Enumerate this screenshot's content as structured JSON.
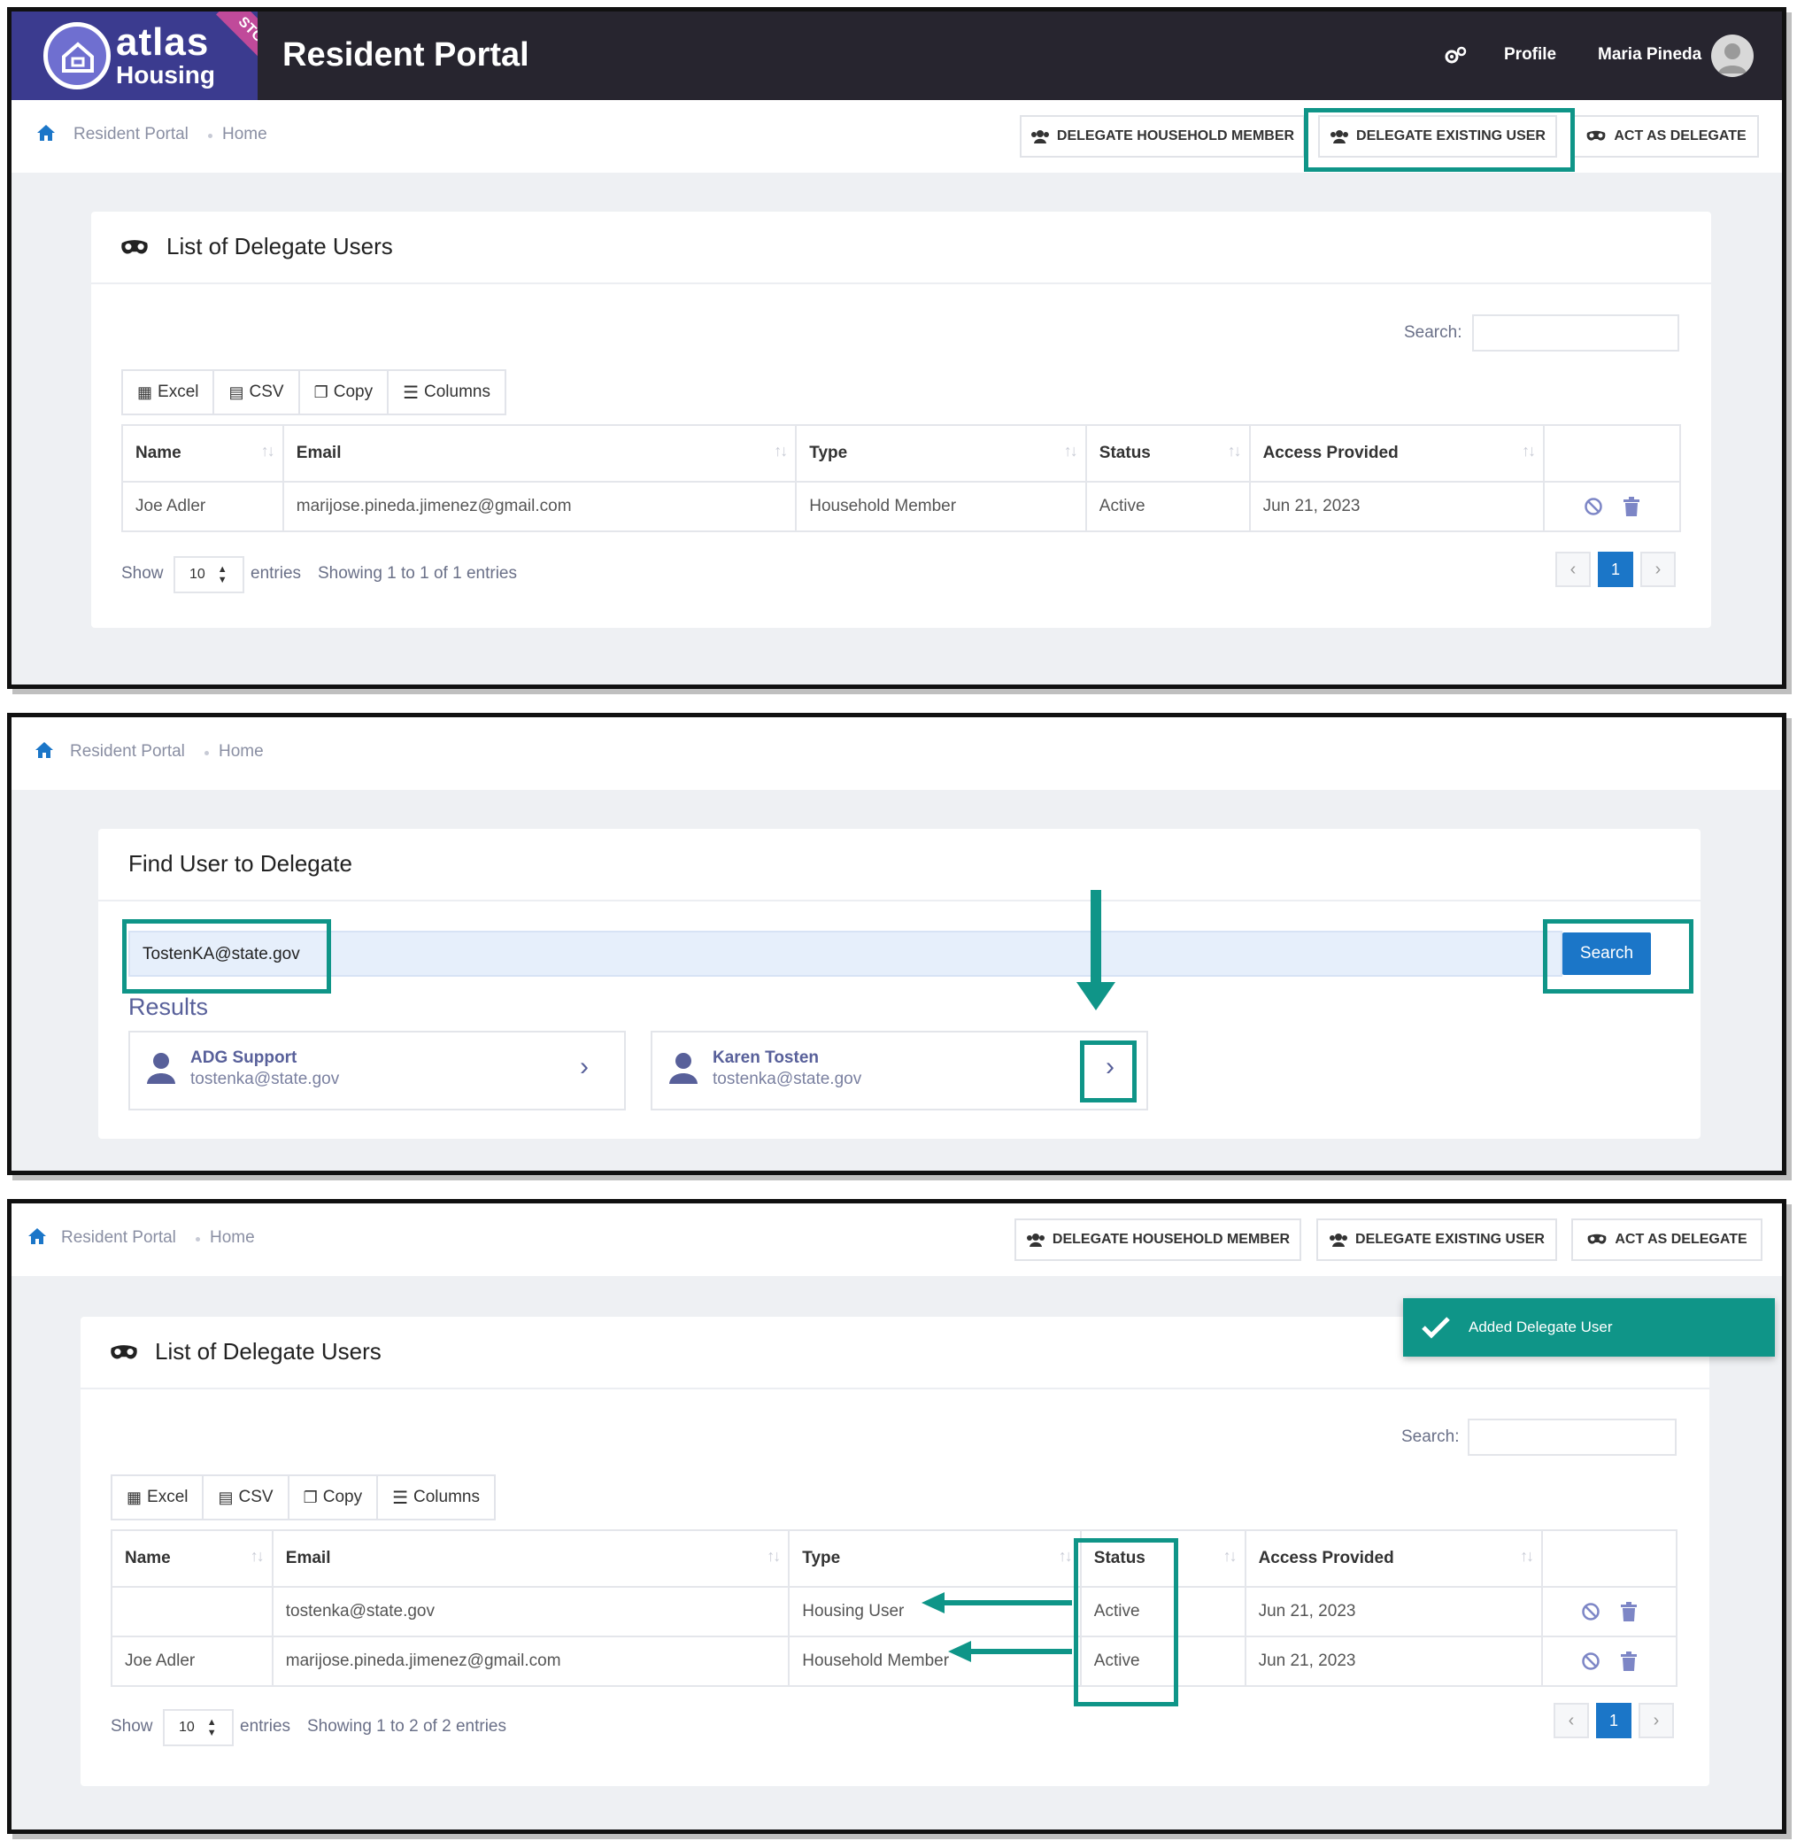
{
  "app": {
    "brand_main": "atlas",
    "brand_sub": "Housing",
    "env_badge": "STG",
    "portal_title": "Resident Portal",
    "nav_profile": "Profile",
    "nav_user": "Maria Pineda"
  },
  "breadcrumb": {
    "root": "Resident Portal",
    "current": "Home"
  },
  "actions": {
    "delegate_household": "DELEGATE HOUSEHOLD MEMBER",
    "delegate_existing": "DELEGATE EXISTING USER",
    "act_as_delegate": "ACT AS DELEGATE"
  },
  "delegate_list": {
    "title": "List of Delegate Users",
    "search_label": "Search:",
    "buttons": [
      "Excel",
      "CSV",
      "Copy",
      "Columns"
    ],
    "columns": [
      "Name",
      "Email",
      "Type",
      "Status",
      "Access Provided"
    ],
    "show_label": "Show",
    "entries_value": "10",
    "entries_label": "entries"
  },
  "panel1": {
    "rows": [
      {
        "name": "Joe Adler",
        "email": "marijose.pineda.jimenez@gmail.com",
        "type": "Household Member",
        "status": "Active",
        "access": "Jun 21, 2023"
      }
    ],
    "info": "Showing 1 to 1 of 1 entries",
    "page": "1"
  },
  "panel2": {
    "title": "Find User to Delegate",
    "input_value": "TostenKA@state.gov",
    "search_button": "Search",
    "results_label": "Results",
    "results": [
      {
        "name": "ADG Support",
        "email": "tostenka@state.gov"
      },
      {
        "name": "Karen Tosten",
        "email": "tostenka@state.gov"
      }
    ]
  },
  "panel3": {
    "toast": "Added Delegate User",
    "rows": [
      {
        "name": "",
        "email": "tostenka@state.gov",
        "type": "Housing User",
        "status": "Active",
        "access": "Jun 21, 2023"
      },
      {
        "name": "Joe Adler",
        "email": "marijose.pineda.jimenez@gmail.com",
        "type": "Household Member",
        "status": "Active",
        "access": "Jun 21, 2023"
      }
    ],
    "info": "Showing 1 to 2 of 2 entries",
    "page": "1"
  },
  "colors": {
    "nav_bg": "#27252f",
    "accent_teal": "#0f9588",
    "primary_blue": "#1b76c8",
    "logo_bg": "#3b3b8f"
  }
}
